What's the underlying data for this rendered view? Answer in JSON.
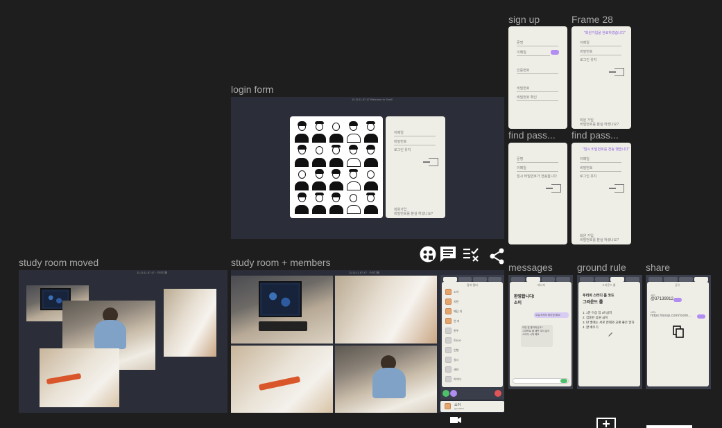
{
  "frames": {
    "sign_up": "sign up",
    "frame_28": "Frame 28",
    "login_form": "login form",
    "find_pass_1": "find pass...",
    "find_pass_2": "find pass...",
    "study_room_moved": "study room moved",
    "study_room_members": "study room + members",
    "messages": "messages",
    "ground_rule": "ground rule",
    "share": "share"
  },
  "signup_form": {
    "name": "문명",
    "email": "이메일",
    "email_button": "인증",
    "code": "인증번호",
    "password": "비밀번호",
    "password_confirm": "비밀번호 확인"
  },
  "frame28_form": {
    "headline": "\"회원가입을 완료하였습니다\"",
    "email": "이메일",
    "password": "비밀번호",
    "remember": "로그인 유지",
    "footer_1": "회원 가입",
    "footer_2": "비밀번호를 분실 하셨나요?"
  },
  "login": {
    "topbar": "11:11:11 87 47 Welcome to Sosil!",
    "email": "이메일",
    "password": "비밀번호",
    "remember": "로그인 유지",
    "footer_1": "회원가입",
    "footer_2": "비밀번호를 분실 하셨나요?"
  },
  "find_pass_1": {
    "name": "문명",
    "email": "이메일",
    "note": "임시 비밀번호가 전송됩니다"
  },
  "find_pass_2": {
    "headline": "\"임시 비밀번호를 전송 했습니다\"",
    "email": "이메일",
    "password": "비밀번호",
    "remember": "로그인 유지",
    "footer_1": "회원 가입",
    "footer_2": "비밀번호를 분실 하셨나요?"
  },
  "study_room": {
    "topbar": "11:11:11 87 47 · 스터디룸",
    "members_title": "참여 멤버",
    "members": [
      "소이",
      "지민",
      "예담 지",
      "연 지",
      "현우",
      "토요스",
      "인형",
      "실시",
      "세라",
      "아이다"
    ],
    "me_name": "소이",
    "me_sub": "@soi0000"
  },
  "messages_panel": {
    "title": "메시지",
    "welcome": "환영합니다!",
    "welcome_name": "소이",
    "bubble_1": "오늘 하루도 화이팅 해요!",
    "bubble_2": "어떤 질 좋아하신요?",
    "bubble_3": "그래프로 볼 때면 우리 같이 스터디 시작 해요"
  },
  "ground_rule_panel": {
    "title": "그라운드 룰",
    "heading_1": "우리의 스터디 룸 코드",
    "heading_2": "그라운드 룰",
    "rules": [
      "1. 1분 이상 잠 off 금지",
      "2. 집중된 음원 금지",
      "3. 탄 밸에는 서로 면제와 교환 좋은 말하",
      "4. 잘 배우기"
    ]
  },
  "share_panel": {
    "title": "공유",
    "code_label": "코드",
    "code": "@37139912",
    "url_label": "URL",
    "url": "https://sosp.com/room..."
  },
  "icons": {
    "game": "face-icon",
    "chat": "chat-icon",
    "checklist": "checklist-icon",
    "share": "share-icon",
    "copy": "copy-icon",
    "camera": "camera-icon",
    "add": "add-box-icon"
  },
  "colors": {
    "canvas": "#1e1e1e",
    "frame_dark": "#2b2e38",
    "panel": "#efeee6",
    "accent": "#b18cf2"
  }
}
